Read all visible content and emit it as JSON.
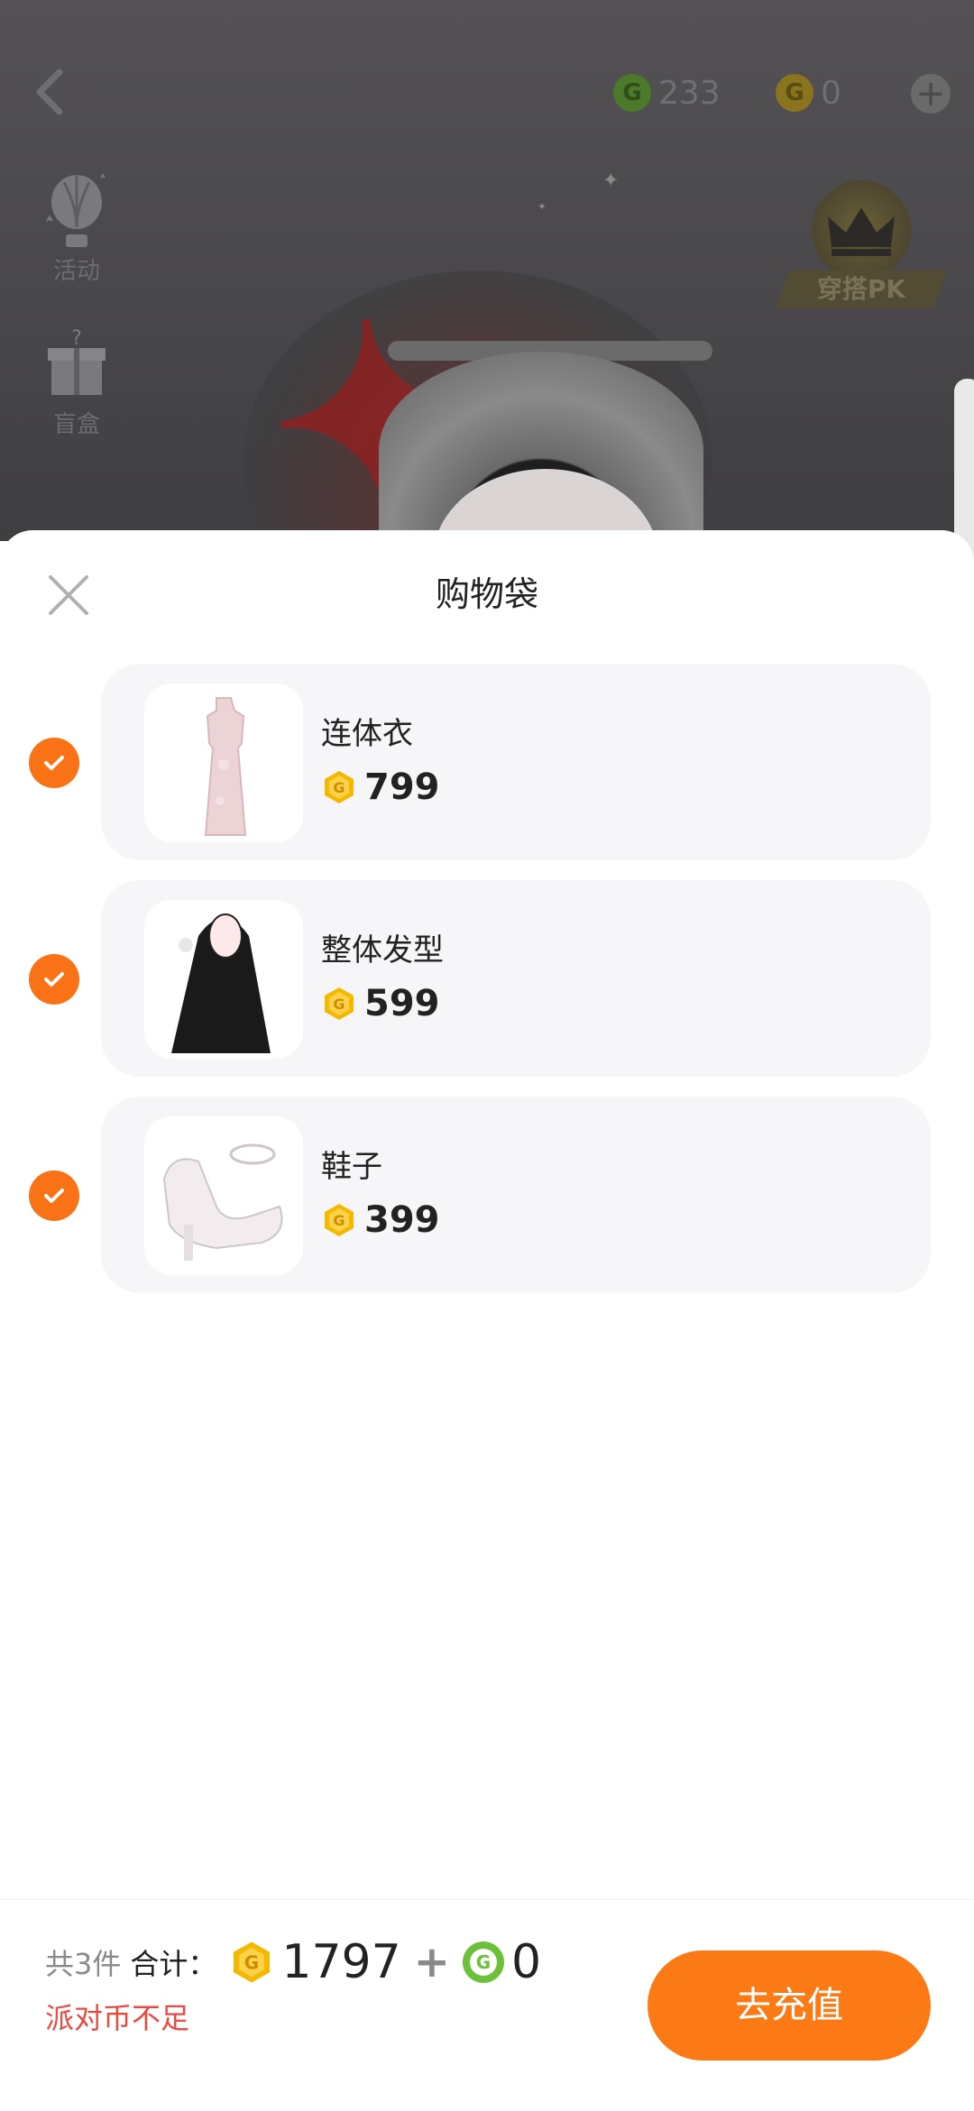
{
  "top_bar": {
    "green_currency_value": "233",
    "gold_currency_value": "0",
    "plus_label": "+"
  },
  "side_menu": [
    {
      "label": "活动",
      "icon": "hot-air-balloon-icon"
    },
    {
      "label": "盲盒",
      "icon": "gift-box-icon"
    }
  ],
  "outfit_pk": {
    "label": "穿搭PK",
    "icon": "crown-icon"
  },
  "sheet": {
    "title": "购物袋",
    "items": [
      {
        "name": "连体衣",
        "price": "799",
        "checked": true,
        "image": "qipao-dress-image"
      },
      {
        "name": "整体发型",
        "price": "599",
        "checked": true,
        "image": "long-black-hair-image"
      },
      {
        "name": "鞋子",
        "price": "399",
        "checked": true,
        "image": "white-heels-image"
      }
    ]
  },
  "footer": {
    "count_text": "共3件",
    "sum_label": "合计：",
    "gold_total": "1797",
    "plus": "+",
    "green_total": "0",
    "warning": "派对币不足",
    "recharge_label": "去充值"
  },
  "colors": {
    "accent_orange": "#fb7a16",
    "warning_red": "#e94a3f",
    "coin_gold": "#f5b800",
    "coin_green": "#6cc03a"
  }
}
